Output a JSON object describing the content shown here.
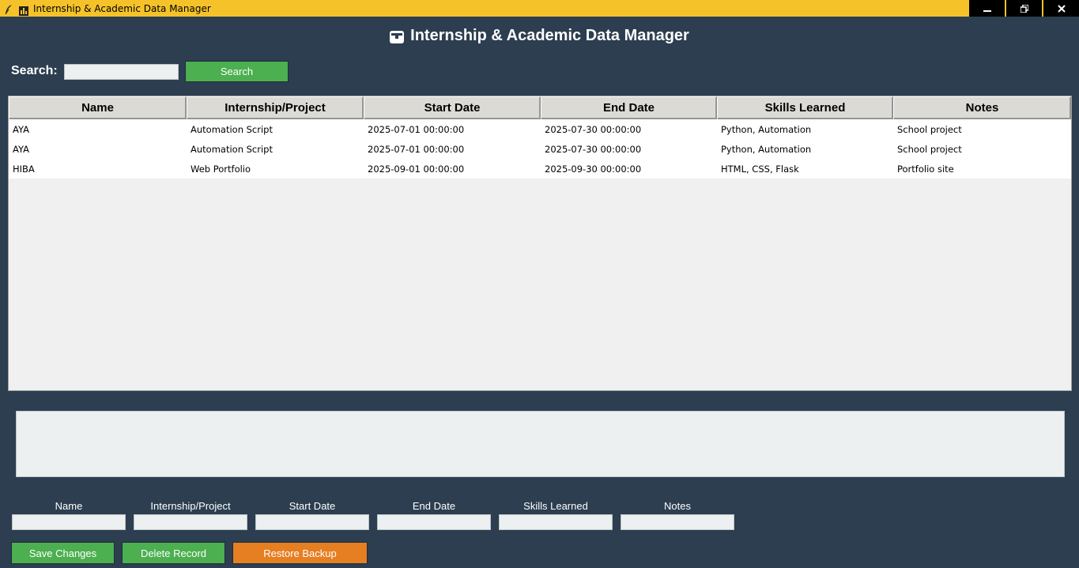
{
  "window": {
    "title": "Internship & Academic Data Manager",
    "minimize_glyph": "🗕",
    "restore_glyph": "🗗",
    "close_glyph": "✕"
  },
  "heading": {
    "icon": "briefcase-icon",
    "text": "Internship & Academic Data Manager"
  },
  "search": {
    "label": "Search:",
    "value": "",
    "button_label": "Search"
  },
  "table": {
    "columns": [
      "Name",
      "Internship/Project",
      "Start Date",
      "End Date",
      "Skills Learned",
      "Notes"
    ],
    "rows": [
      [
        "AYA",
        "Automation Script",
        "2025-07-01 00:00:00",
        "2025-07-30 00:00:00",
        "Python, Automation",
        "School project"
      ],
      [
        "AYA",
        "Automation Script",
        "2025-07-01 00:00:00",
        "2025-07-30 00:00:00",
        "Python, Automation",
        "School project"
      ],
      [
        "HIBA",
        "Web Portfolio",
        "2025-09-01 00:00:00",
        "2025-09-30 00:00:00",
        "HTML, CSS, Flask",
        "Portfolio site"
      ]
    ]
  },
  "details_text": "",
  "form": {
    "fields": [
      {
        "label": "Name",
        "value": ""
      },
      {
        "label": "Internship/Project",
        "value": ""
      },
      {
        "label": "Start Date",
        "value": ""
      },
      {
        "label": "End Date",
        "value": ""
      },
      {
        "label": "Skills Learned",
        "value": ""
      },
      {
        "label": "Notes",
        "value": ""
      }
    ]
  },
  "actions": {
    "save_label": "Save Changes",
    "delete_label": "Delete Record",
    "restore_label": "Restore Backup"
  },
  "colors": {
    "background": "#2c3e50",
    "titlebar": "#f5c329",
    "button_green": "#4caf50",
    "button_orange": "#e67e22"
  }
}
